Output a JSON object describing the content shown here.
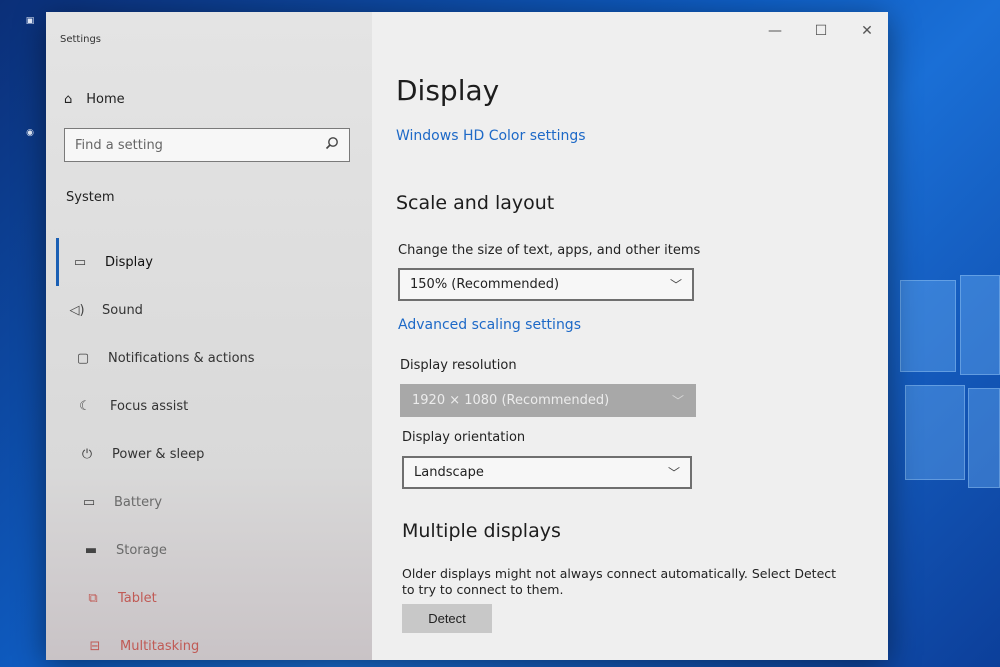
{
  "window": {
    "title": "Settings",
    "controls": {
      "minimize": "—",
      "maximize": "☐",
      "close": "✕"
    }
  },
  "sidebar": {
    "home_label": "Home",
    "search_placeholder": "Find a setting",
    "section_label": "System",
    "items": [
      {
        "label": "Display",
        "icon": "monitor-icon"
      },
      {
        "label": "Sound",
        "icon": "speaker-icon"
      },
      {
        "label": "Notifications & actions",
        "icon": "notification-icon"
      },
      {
        "label": "Focus assist",
        "icon": "moon-icon"
      },
      {
        "label": "Power & sleep",
        "icon": "power-icon"
      },
      {
        "label": "Battery",
        "icon": "battery-icon"
      },
      {
        "label": "Storage",
        "icon": "storage-icon"
      },
      {
        "label": "Tablet",
        "icon": "tablet-icon"
      },
      {
        "label": "Multitasking",
        "icon": "multitasking-icon"
      }
    ]
  },
  "main": {
    "title": "Display",
    "hd_color_link": "Windows HD Color settings",
    "scale_heading": "Scale and layout",
    "scale_label": "Change the size of text, apps, and other items",
    "scale_value": "150% (Recommended)",
    "advanced_link": "Advanced scaling settings",
    "resolution_label": "Display resolution",
    "resolution_value": "1920 × 1080 (Recommended)",
    "orientation_label": "Display orientation",
    "orientation_value": "Landscape",
    "multiple_heading": "Multiple displays",
    "multiple_text": "Older displays might not always connect automatically. Select Detect to try to connect to them.",
    "detect_label": "Detect"
  },
  "colors": {
    "accent": "#1d69c7",
    "active_indicator": "#1a5fb4",
    "wallpaper": "#0f5fc6"
  }
}
